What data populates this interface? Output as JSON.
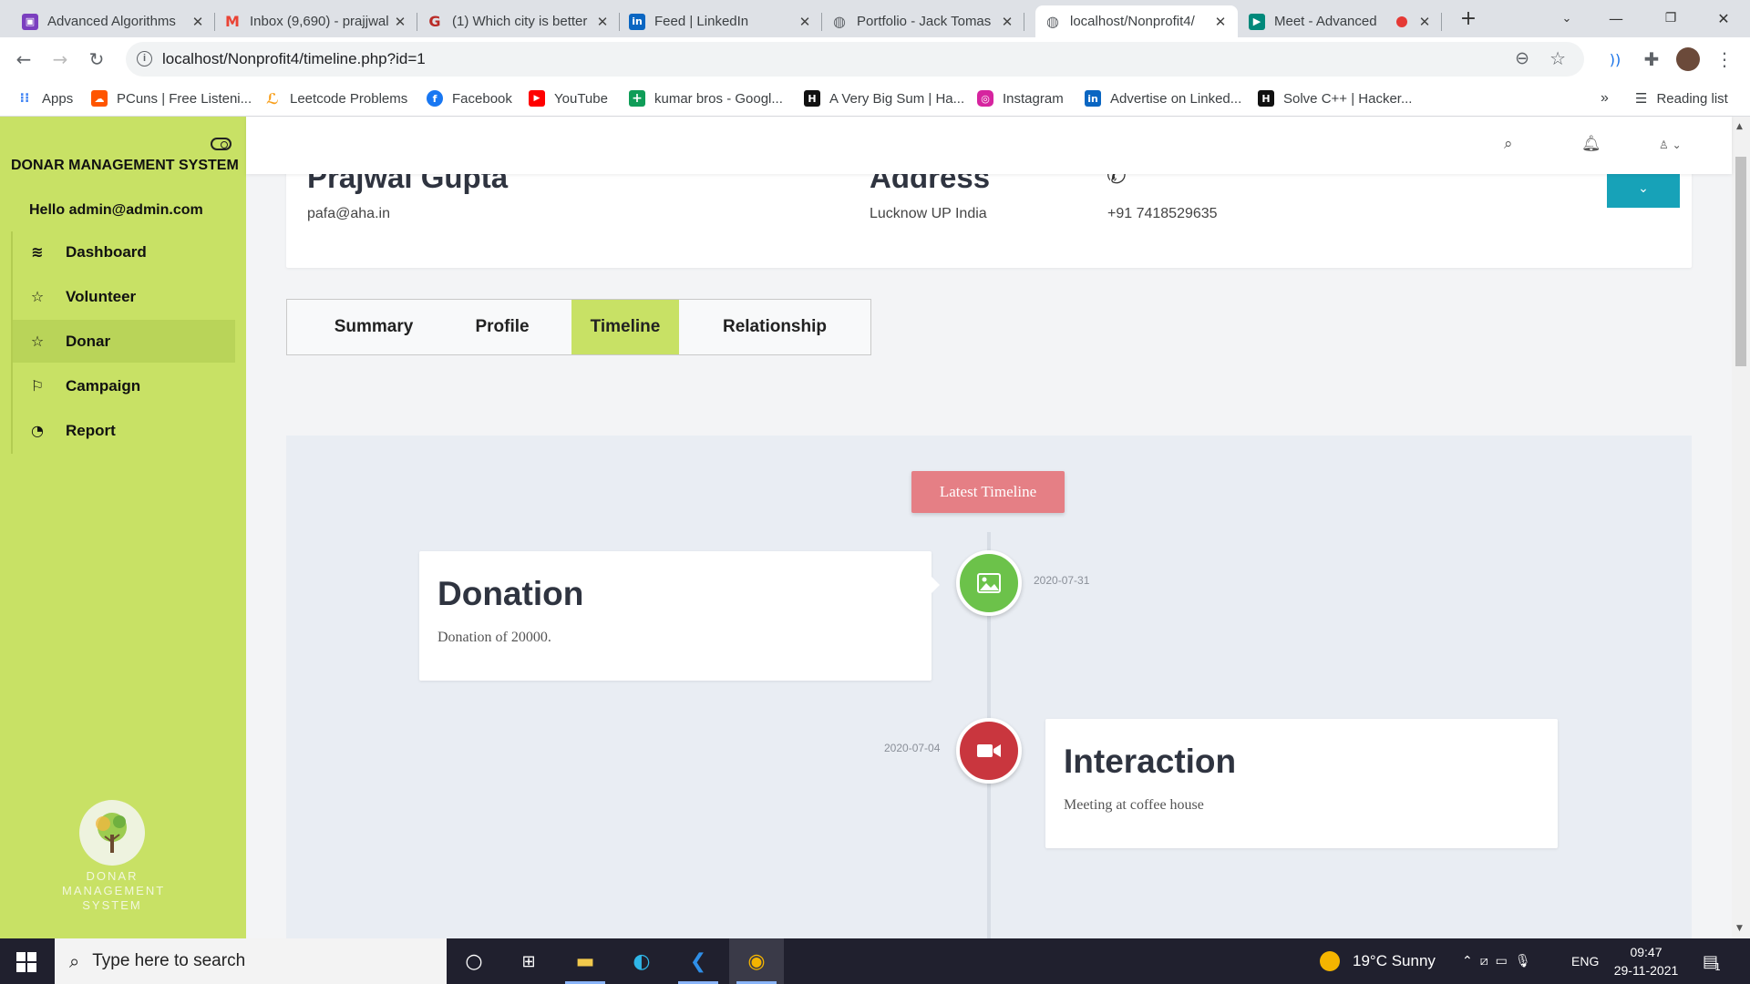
{
  "browser": {
    "tabs": [
      {
        "title": "Advanced Algorithms",
        "icon": "classroom-icon",
        "color": "#7b3fbf",
        "glyph": "▣"
      },
      {
        "title": "Inbox (9,690) - prajjwal",
        "icon": "gmail-icon",
        "color": "#ea4335",
        "glyph": "M"
      },
      {
        "title": "(1) Which city is better",
        "icon": "quora-icon",
        "color": "#b92b27",
        "glyph": "Q"
      },
      {
        "title": "Feed | LinkedIn",
        "icon": "linkedin-icon",
        "color": "#0a66c2",
        "glyph": "in"
      },
      {
        "title": "Portfolio - Jack Tomas",
        "icon": "globe-icon",
        "color": "#5f6368",
        "glyph": "◍"
      },
      {
        "title": "localhost/Nonprofit4/",
        "icon": "globe-icon",
        "color": "#5f6368",
        "glyph": "◍"
      },
      {
        "title": "Meet - Advanced",
        "icon": "meet-icon",
        "color": "#00897b",
        "glyph": "▶"
      }
    ],
    "active_tab_index": 5,
    "url": "localhost/Nonprofit4/timeline.php?id=1",
    "bookmarks": [
      {
        "label": "Apps",
        "icon": "apps-grid-icon",
        "color": "#4285f4",
        "glyph": "⋮⋮"
      },
      {
        "label": "PCuns | Free Listeni...",
        "icon": "soundcloud-icon",
        "color": "#ff5500",
        "glyph": "☁"
      },
      {
        "label": "Leetcode Problems",
        "icon": "leetcode-icon",
        "color": "#f89f1b",
        "glyph": "L"
      },
      {
        "label": "Facebook",
        "icon": "facebook-icon",
        "color": "#1877f2",
        "glyph": "f"
      },
      {
        "label": "YouTube",
        "icon": "youtube-icon",
        "color": "#ff0000",
        "glyph": "▶"
      },
      {
        "label": "kumar bros - Googl...",
        "icon": "sheets-icon",
        "color": "#0f9d58",
        "glyph": "+"
      },
      {
        "label": "A Very Big Sum | Ha...",
        "icon": "hackerrank-icon",
        "color": "#111111",
        "glyph": "H"
      },
      {
        "label": "Instagram",
        "icon": "instagram-icon",
        "color": "#d6249f",
        "glyph": "◎"
      },
      {
        "label": "Advertise on Linked...",
        "icon": "linkedin-icon",
        "color": "#0a66c2",
        "glyph": "in"
      },
      {
        "label": "Solve C++ | Hacker...",
        "icon": "hackerrank-icon",
        "color": "#111111",
        "glyph": "H"
      }
    ],
    "reading_list": "Reading list",
    "more_bookmarks": "»"
  },
  "sidebar": {
    "title": "DONAR MANAGEMENT SYSTEM",
    "greeting": "Hello admin@admin.com",
    "items": [
      {
        "label": "Dashboard",
        "icon": "layers-icon",
        "glyph": "≋"
      },
      {
        "label": "Volunteer",
        "icon": "star-icon",
        "glyph": "☆"
      },
      {
        "label": "Donar",
        "icon": "star-icon",
        "glyph": "☆"
      },
      {
        "label": "Campaign",
        "icon": "flag-icon",
        "glyph": "⚐"
      },
      {
        "label": "Report",
        "icon": "pie-chart-icon",
        "glyph": "◔"
      }
    ],
    "active_index": 2,
    "logo_text": [
      "DONAR",
      "MANAGEMENT",
      "SYSTEM"
    ],
    "accent": "#c8e165"
  },
  "profile": {
    "name": "Prajwal Gupta",
    "email": "pafa@aha.in",
    "address_heading": "Address",
    "address": "Lucknow UP India",
    "phone": "+91 7418529635"
  },
  "tabs": {
    "items": [
      "Summary",
      "Profile",
      "Timeline",
      "Relationship"
    ],
    "active_index": 2
  },
  "timeline": {
    "badge": "Latest Timeline",
    "entries": [
      {
        "title": "Donation",
        "description": "Donation of 20000.",
        "date": "2020-07-31",
        "icon": "image-icon",
        "color": "#6cc24a"
      },
      {
        "title": "Interaction",
        "description": "Meeting at coffee house",
        "date": "2020-07-04",
        "icon": "video-camera-icon",
        "color": "#c9363e"
      }
    ]
  },
  "taskbar": {
    "search_placeholder": "Type here to search",
    "weather": "19°C  Sunny",
    "language": "ENG",
    "time": "09:47",
    "date": "29-11-2021",
    "notifications": "1"
  }
}
